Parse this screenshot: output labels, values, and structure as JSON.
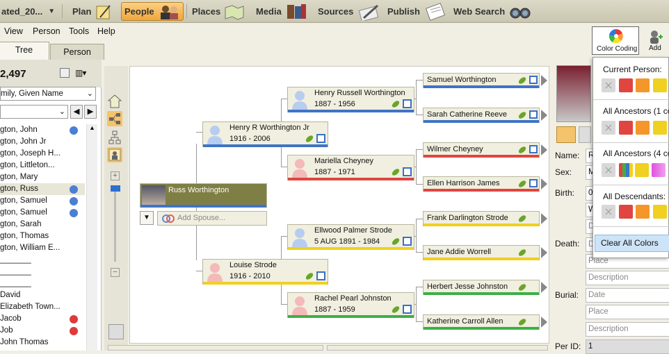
{
  "topbar": {
    "file_title": "ated_20...",
    "plan": "Plan",
    "people": "People",
    "places": "Places",
    "media": "Media",
    "sources": "Sources",
    "publish": "Publish",
    "web_search": "Web Search"
  },
  "menu": {
    "view": "View",
    "person": "Person",
    "tools": "Tools",
    "help": "Help"
  },
  "toolbar_right": {
    "color_coding": "Color Coding",
    "add": "Add"
  },
  "tabs": {
    "tree": "Tree",
    "person": "Person"
  },
  "left": {
    "count": "2,497",
    "sort": "mily, Given Name",
    "items": [
      {
        "name": "gton, John",
        "dot": "#4a7fd4"
      },
      {
        "name": "gton, John Jr",
        "dot": ""
      },
      {
        "name": "gton, Joseph H...",
        "dot": ""
      },
      {
        "name": "gton,  Littleton...",
        "dot": ""
      },
      {
        "name": "gton, Mary",
        "dot": ""
      },
      {
        "name": "gton, Russ",
        "dot": "#4a7fd4"
      },
      {
        "name": "gton, Samuel",
        "dot": "#4a7fd4"
      },
      {
        "name": "gton, Samuel",
        "dot": "#4a7fd4"
      },
      {
        "name": "gton, Sarah",
        "dot": ""
      },
      {
        "name": "gton, Thomas",
        "dot": ""
      },
      {
        "name": "gton, William E...",
        "dot": ""
      },
      {
        "name": "_______",
        "dot": ""
      },
      {
        "name": "_______",
        "dot": ""
      },
      {
        "name": "_______",
        "dot": ""
      },
      {
        "name": "David",
        "dot": ""
      },
      {
        "name": "Elizabeth Town...",
        "dot": ""
      },
      {
        "name": "Jacob",
        "dot": "#e03a3a"
      },
      {
        "name": "Job",
        "dot": "#e03a3a"
      },
      {
        "name": "John Thomas",
        "dot": ""
      }
    ]
  },
  "tree": {
    "root": {
      "name": "Russ Worthington",
      "add_spouse": "Add Spouse..."
    },
    "father": {
      "name": "Henry R Worthington Jr",
      "dates": "1916 - 2006"
    },
    "mother": {
      "name": "Louise Strode",
      "dates": "1916 - 2010"
    },
    "pgf": {
      "name": "Henry Russell Worthington",
      "dates": "1887 - 1956"
    },
    "pgm": {
      "name": "Mariella Cheyney",
      "dates": "1887 - 1971"
    },
    "mgf": {
      "name": "Ellwood Palmer Strode",
      "dates": "5 AUG 1891 - 1984"
    },
    "mgm": {
      "name": "Rachel Pearl Johnston",
      "dates": "1887 - 1959"
    },
    "g1": "Samuel Worthington",
    "g2": "Sarah Catherine Reeve",
    "g3": "Wilmer Cheyney",
    "g4": "Ellen Harrison James",
    "g5": "Frank Darlington Strode",
    "g6": "Jane Addie Worrell",
    "g7": "Herbert Jesse Johnston",
    "g8": "Katherine Carroll Allen"
  },
  "details": {
    "name": "Name:",
    "sex": "Sex:",
    "birth": "Birth:",
    "death": "Death:",
    "burial": "Burial:",
    "perid": "Per ID:",
    "name_val": "R",
    "sex_val": "M",
    "birth_val": "0",
    "birth_place": "W",
    "place": "Place",
    "description": "Description",
    "date": "Date",
    "perid_val": "1"
  },
  "popup": {
    "current": "Current Person:",
    "all_anc1": "All Ancestors (1 co",
    "all_anc4": "All Ancestors (4 co",
    "all_desc": "All Descendants:",
    "clear": "Clear All Colors"
  },
  "colors": {
    "blue": "#3f74c6",
    "red": "#e0453f",
    "yellow": "#f0d020",
    "green": "#3db045",
    "orange": "#f5962a"
  }
}
